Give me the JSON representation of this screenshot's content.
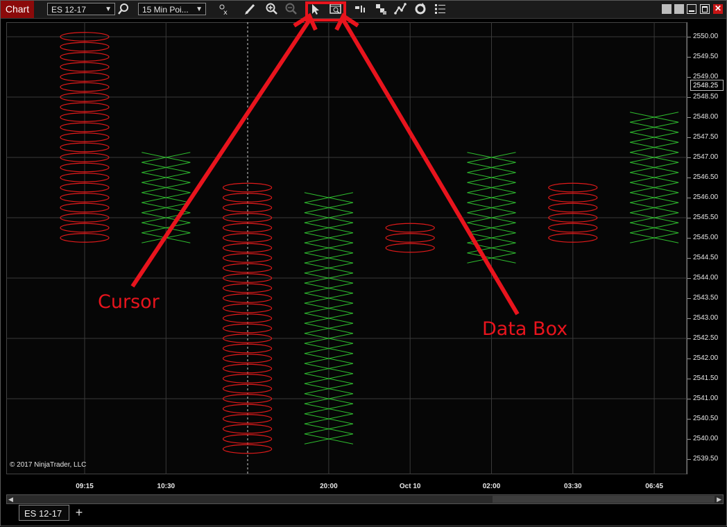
{
  "toolbar": {
    "chart_tab": "Chart",
    "instrument": "ES 12-17",
    "interval": "15 Min Poi...",
    "icons": [
      "search-icon",
      "indicators-icon",
      "drawing-pencil-icon",
      "zoom-in-icon",
      "zoom-out-icon",
      "cursor-icon",
      "data-box-icon",
      "bar-style-icon",
      "chart-style-icon",
      "strategies-icon",
      "reload-icon",
      "properties-icon"
    ],
    "highlight_color": "#e8141d"
  },
  "chart": {
    "copyright": "© 2017 NinjaTrader, LLC",
    "current_price": "2548.25",
    "y_labels": [
      "2550.00",
      "2549.50",
      "2549.00",
      "2548.50",
      "2548.00",
      "2547.50",
      "2547.00",
      "2546.50",
      "2546.00",
      "2545.50",
      "2545.00",
      "2544.50",
      "2544.00",
      "2543.50",
      "2543.00",
      "2542.50",
      "2542.00",
      "2541.50",
      "2541.00",
      "2540.50",
      "2540.00",
      "2539.50"
    ],
    "x_labels": [
      {
        "label": "09:15",
        "col": 0
      },
      {
        "label": "10:30",
        "col": 1
      },
      {
        "label": "20:00",
        "col": 3
      },
      {
        "label": "Oct 10",
        "col": 4
      },
      {
        "label": "02:00",
        "col": 5
      },
      {
        "label": "03:30",
        "col": 6
      },
      {
        "label": "06:45",
        "col": 7
      }
    ]
  },
  "chart_data": {
    "type": "point-and-figure",
    "box_size": 0.25,
    "colors": {
      "O": "#e21a1a",
      "X": "#2fbd2f"
    },
    "columns": [
      {
        "type": "O",
        "high": 2550.0,
        "low": 2545.0
      },
      {
        "type": "X",
        "low": 2545.0,
        "high": 2547.0
      },
      {
        "type": "O",
        "high": 2546.25,
        "low": 2539.75
      },
      {
        "type": "X",
        "low": 2540.0,
        "high": 2546.0
      },
      {
        "type": "O",
        "high": 2545.25,
        "low": 2544.75
      },
      {
        "type": "X",
        "low": 2544.5,
        "high": 2547.0
      },
      {
        "type": "O",
        "high": 2546.25,
        "low": 2545.0
      },
      {
        "type": "X",
        "low": 2545.0,
        "high": 2548.0
      }
    ],
    "y_range": [
      2539.5,
      2550.0
    ]
  },
  "annotations": {
    "cursor_label": "Cursor",
    "databox_label": "Data Box"
  },
  "bottom": {
    "tab_label": "ES 12-17",
    "add_label": "+"
  }
}
